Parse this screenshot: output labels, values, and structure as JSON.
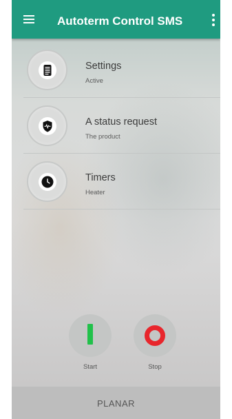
{
  "app_bar": {
    "title": "Autoterm Control SMS",
    "menu_icon": "hamburger-menu-icon",
    "overflow_icon": "more-vert-icon",
    "color": "#1f9b80"
  },
  "menu_items": [
    {
      "title": "Settings",
      "subtitle": "Active",
      "icon": "document-list-icon"
    },
    {
      "title": "A status request",
      "subtitle": "The product",
      "icon": "shield-pulse-icon"
    },
    {
      "title": "Timers",
      "subtitle": "Heater",
      "icon": "clock-icon"
    }
  ],
  "controls": {
    "start": {
      "label": "Start",
      "icon": "start-bar-icon",
      "color": "#21c14a"
    },
    "stop": {
      "label": "Stop",
      "icon": "stop-ring-icon",
      "color": "#e8262c"
    }
  },
  "bottom_bar": {
    "label": "PLANAR"
  }
}
